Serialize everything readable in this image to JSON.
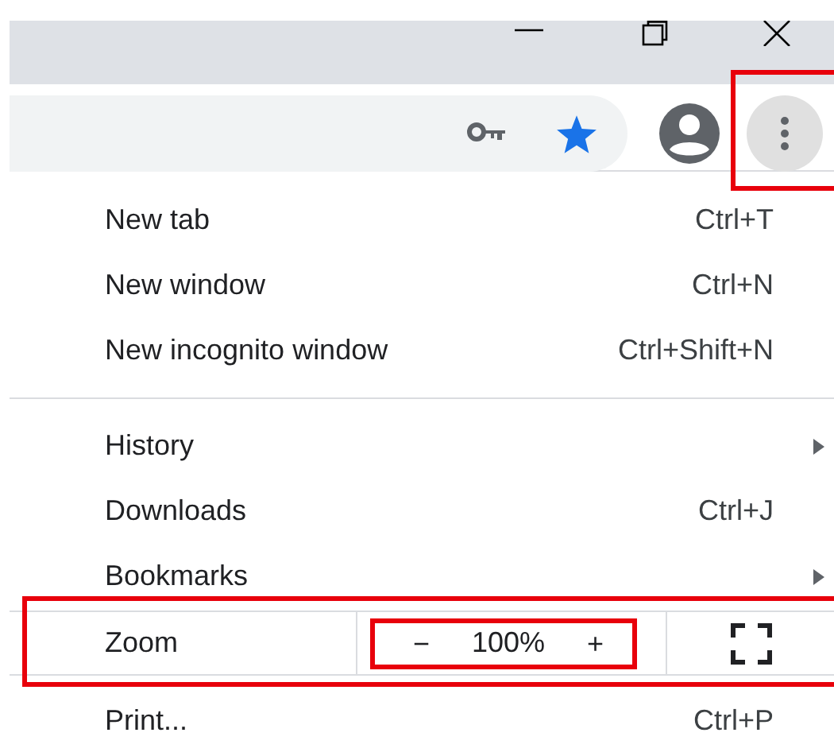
{
  "menu_button": {
    "highlighted": true
  },
  "menu": {
    "items": [
      {
        "kind": "item",
        "label": "New tab",
        "shortcut": "Ctrl+T",
        "submenu": false
      },
      {
        "kind": "item",
        "label": "New window",
        "shortcut": "Ctrl+N",
        "submenu": false
      },
      {
        "kind": "item",
        "label": "New incognito window",
        "shortcut": "Ctrl+Shift+N",
        "submenu": false
      },
      {
        "kind": "separator"
      },
      {
        "kind": "item",
        "label": "History",
        "submenu": true
      },
      {
        "kind": "item",
        "label": "Downloads",
        "shortcut": "Ctrl+J",
        "submenu": false
      },
      {
        "kind": "item",
        "label": "Bookmarks",
        "submenu": true
      },
      {
        "kind": "zoom",
        "label": "Zoom",
        "minus": "−",
        "value": "100%",
        "plus": "+",
        "highlighted": true,
        "controls_highlighted": true
      },
      {
        "kind": "item",
        "label": "Print...",
        "shortcut": "Ctrl+P",
        "submenu": false
      }
    ]
  }
}
